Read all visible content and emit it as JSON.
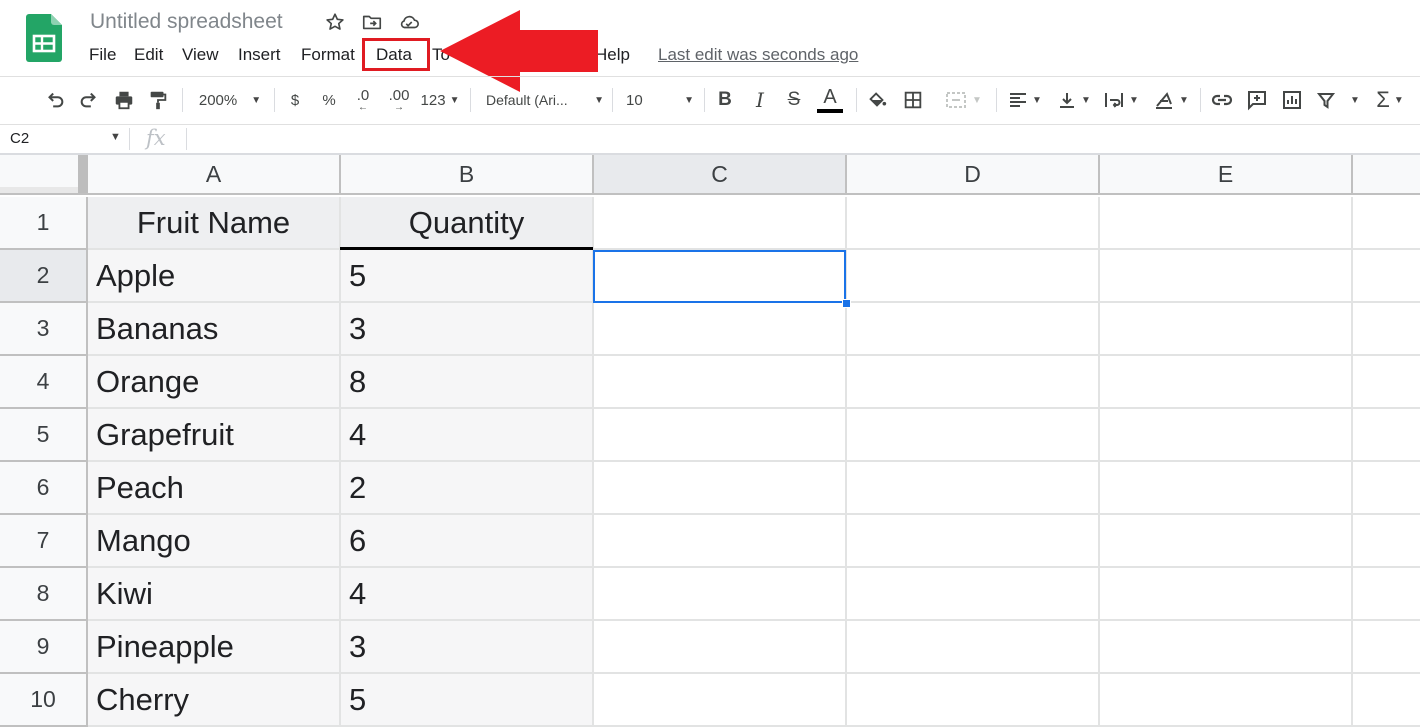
{
  "app": {
    "doc_title": "Untitled spreadsheet",
    "menu": [
      "File",
      "Edit",
      "View",
      "Insert",
      "Format",
      "Data",
      "To",
      "Help"
    ],
    "last_edit": "Last edit was seconds ago",
    "accent_color": "#1a73e8",
    "annotation_color": "#e01b22"
  },
  "toolbar": {
    "zoom": "200%",
    "currency": "$",
    "percent": "%",
    "decrease_decimal": ".0",
    "increase_decimal": ".00",
    "more_formats": "123",
    "font_family": "Default (Ari...",
    "font_size": "10",
    "bold": "B",
    "italic": "I",
    "strikethrough": "S",
    "text_color": "A",
    "sum": "Σ"
  },
  "formula_bar": {
    "name_box": "C2",
    "fx": "fx",
    "content": ""
  },
  "sheet": {
    "columns": [
      "A",
      "B",
      "C",
      "D",
      "E"
    ],
    "rows": [
      "1",
      "2",
      "3",
      "4",
      "5",
      "6",
      "7",
      "8",
      "9",
      "10"
    ],
    "header": [
      "Fruit Name",
      "Quantity"
    ],
    "data": [
      [
        "Apple",
        "5"
      ],
      [
        "Bananas",
        "3"
      ],
      [
        "Orange",
        "8"
      ],
      [
        "Grapefruit",
        "4"
      ],
      [
        "Peach",
        "2"
      ],
      [
        "Mango",
        "6"
      ],
      [
        "Kiwi",
        "4"
      ],
      [
        "Pineapple",
        "3"
      ],
      [
        "Cherry",
        "5"
      ]
    ],
    "selected_cell": "C2"
  }
}
